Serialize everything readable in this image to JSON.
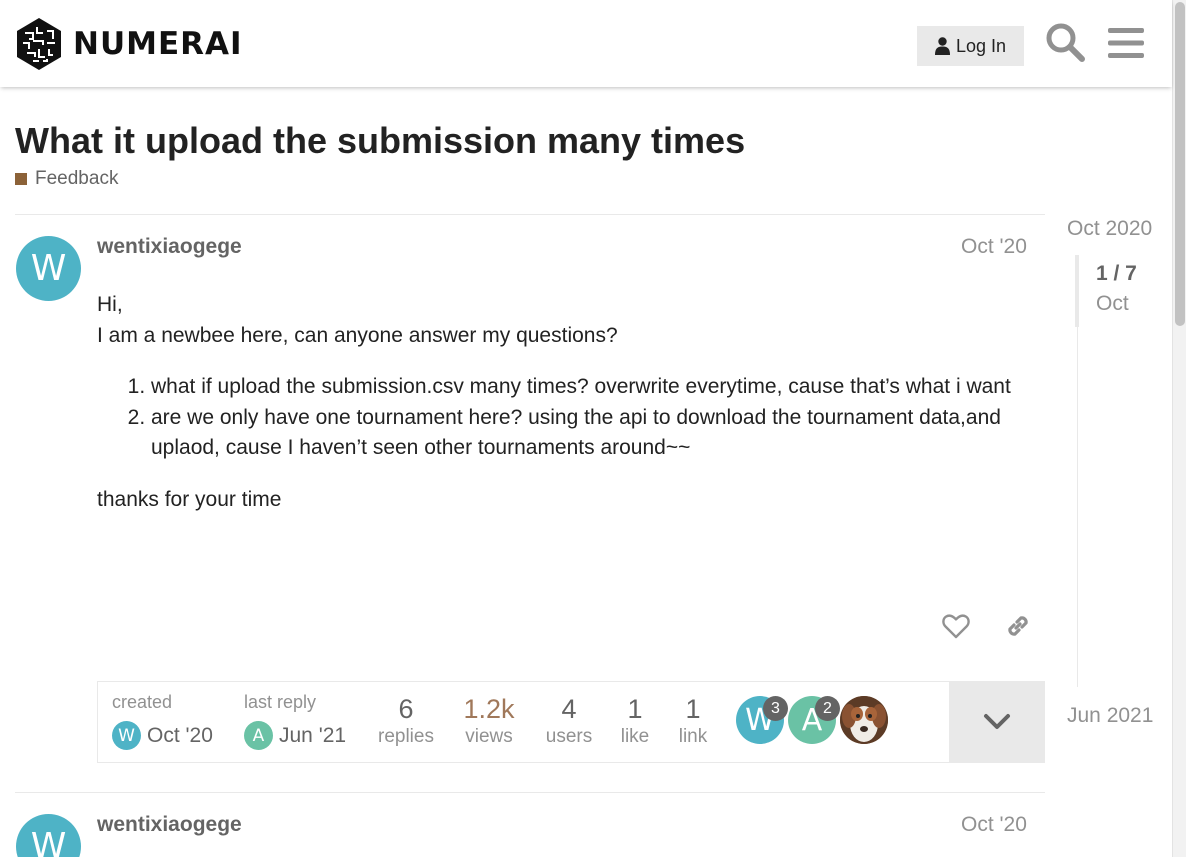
{
  "header": {
    "logo_text": "NUMERAI",
    "login_label": "Log In"
  },
  "topic": {
    "title": "What it upload the submission many times",
    "category": "Feedback",
    "category_color": "#8c6238"
  },
  "posts": [
    {
      "username": "wentixiaogege",
      "avatar_letter": "W",
      "avatar_color": "#4eb3c6",
      "date": "Oct '20",
      "body": {
        "intro_1": "Hi,",
        "intro_2": "I am a newbee here, can anyone answer my questions?",
        "items": [
          "what if upload the submission.csv many times? overwrite everytime, cause that’s what i want",
          "are we only have one tournament here? using the api to download the tournament data,and uplaod, cause I haven’t seen other tournaments around~~"
        ],
        "closing": "thanks for your time"
      }
    },
    {
      "username": "wentixiaogege",
      "avatar_letter": "W",
      "date": "Oct '20"
    }
  ],
  "topic_map": {
    "created_label": "created",
    "created_avatar_letter": "W",
    "created_date": "Oct '20",
    "last_reply_label": "last reply",
    "last_reply_avatar_letter": "A",
    "last_reply_avatar_color": "#6ac2a5",
    "last_reply_date": "Jun '21",
    "stats": [
      {
        "num": "6",
        "label": "replies"
      },
      {
        "num": "1.2k",
        "label": "views"
      },
      {
        "num": "4",
        "label": "users"
      },
      {
        "num": "1",
        "label": "like"
      },
      {
        "num": "1",
        "label": "link"
      }
    ],
    "views_color": "#a0785a",
    "participants": [
      {
        "letter": "W",
        "count": "3",
        "color": "#4eb3c6"
      },
      {
        "letter": "A",
        "count": "2",
        "color": "#6ac2a5"
      },
      {
        "letter": "",
        "count": "",
        "color": "#8a5a3c"
      }
    ]
  },
  "timeline": {
    "top_date": "Oct 2020",
    "position": "1 / 7",
    "position_date": "Oct",
    "bottom_date": "Jun 2021"
  },
  "icons": [
    "user-icon",
    "search-icon",
    "hamburger-menu-icon",
    "heart-icon",
    "link-icon",
    "chevron-down-icon"
  ]
}
